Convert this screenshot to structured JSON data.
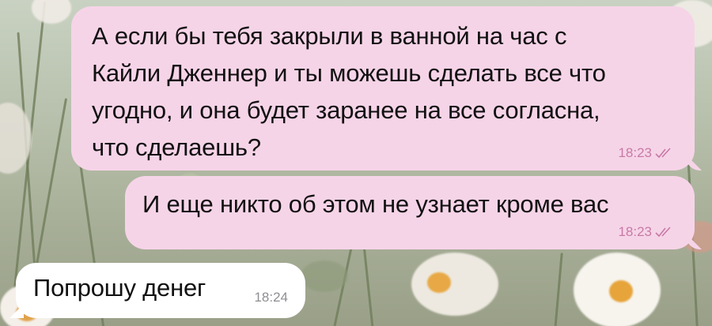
{
  "messages": [
    {
      "direction": "outgoing",
      "lines": [
        "А если бы тебя закрыли в ванной на час с",
        "Кайли Дженнер и ты можешь сделать все что",
        "угодно, и она будет заранее на все согласна,",
        "что сделаешь?"
      ],
      "time": "18:23",
      "status_icon": "double-check-icon"
    },
    {
      "direction": "outgoing",
      "lines": [
        "И еще никто об этом не узнает кроме вас"
      ],
      "time": "18:23",
      "status_icon": "double-check-icon"
    },
    {
      "direction": "incoming",
      "lines": [
        "Попрошу денег"
      ],
      "time": "18:24"
    }
  ],
  "colors": {
    "outgoing_bubble": "#f6d4e8",
    "incoming_bubble": "#ffffff",
    "outgoing_meta": "#c77aa5",
    "incoming_meta": "#8e8e93"
  }
}
